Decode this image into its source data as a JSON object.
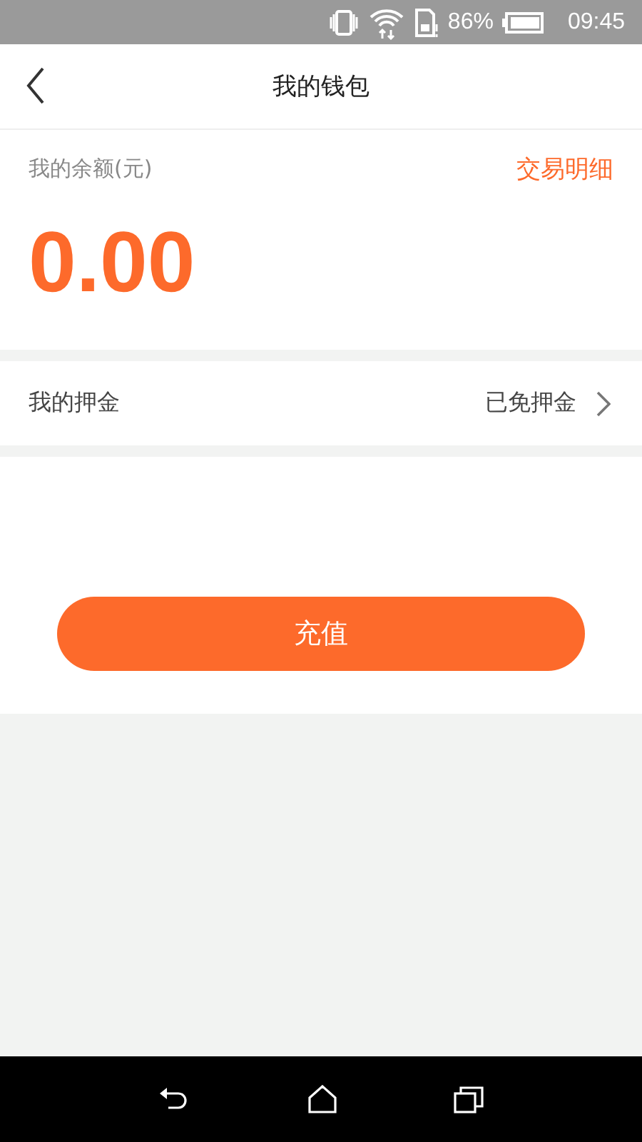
{
  "status_bar": {
    "battery": "86%",
    "time": "09:45"
  },
  "header": {
    "title": "我的钱包"
  },
  "balance": {
    "label": "我的余额(元)",
    "link": "交易明细",
    "amount": "0.00"
  },
  "deposit": {
    "label": "我的押金",
    "value": "已免押金"
  },
  "recharge_button": "充值"
}
